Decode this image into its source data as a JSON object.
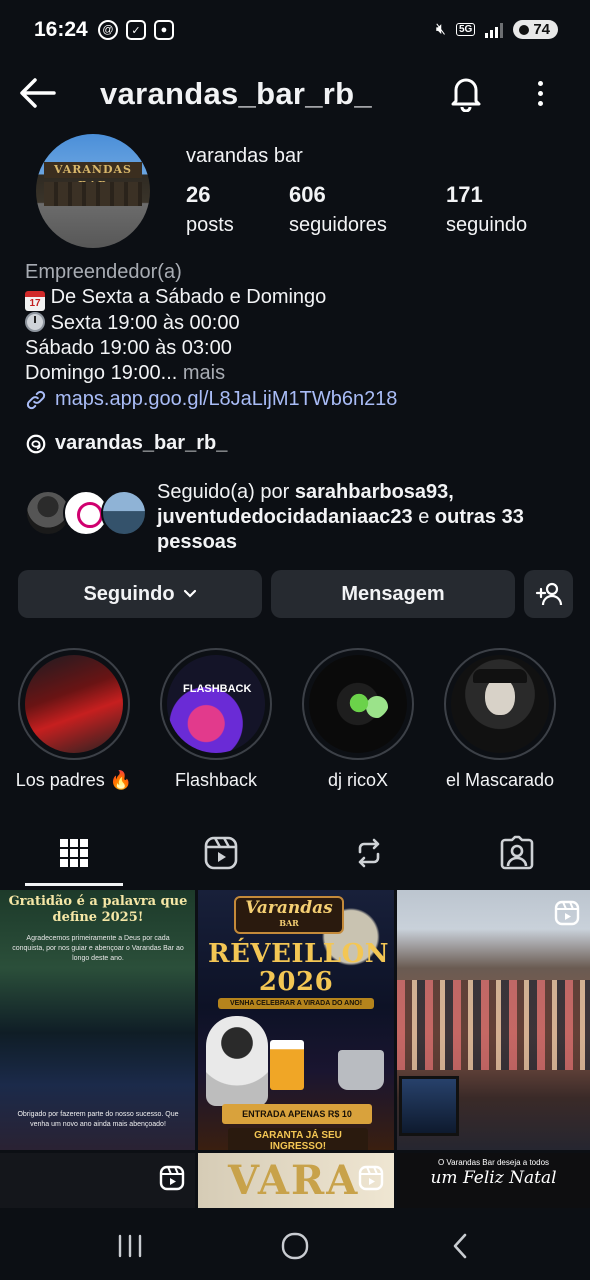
{
  "status_bar": {
    "time": "16:24",
    "network": "5G",
    "battery": "74"
  },
  "header": {
    "username": "varandas_bar_rb_",
    "icons": [
      "back-arrow-icon",
      "bell-icon",
      "more-vertical-icon"
    ]
  },
  "profile": {
    "avatar_sign": "VARANDAS BAR",
    "display_name": "varandas bar",
    "stats": {
      "posts": {
        "value": "26",
        "label": "posts"
      },
      "followers": {
        "value": "606",
        "label": "seguidores"
      },
      "following": {
        "value": "171",
        "label": "seguindo"
      }
    },
    "category": "Empreendedor(a)",
    "bio_lines": [
      "De Sexta a Sábado e Domingo",
      "Sexta 19:00 às 00:00",
      "Sábado 19:00 às 03:00",
      "Domingo 19:00..."
    ],
    "bio_more": "mais",
    "link": "maps.app.goo.gl/L8JaLijM1TWb6n218",
    "threads_handle": "varandas_bar_rb_",
    "followed_by": {
      "prefix": "Seguido(a) por",
      "user1": "sarahbarbosa93,",
      "user2": "juventudedocidadaniaac23",
      "connector": "e",
      "others": "outras 33 pessoas"
    }
  },
  "actions": {
    "following_label": "Seguindo",
    "message_label": "Mensagem"
  },
  "highlights": [
    {
      "label": "Los padres 🔥"
    },
    {
      "label": "Flashback",
      "cover_text": "FLASHBACK"
    },
    {
      "label": "dj ricoX"
    },
    {
      "label": "el Mascarado"
    }
  ],
  "tabs": [
    "grid-icon",
    "reels-icon",
    "reposts-icon",
    "tagged-icon"
  ],
  "posts": {
    "p1": {
      "title": "Gratidão é a palavra que define 2025!",
      "body": "Agradecemos primeiramente a Deus por cada conquista, por nos guiar e abençoar o Varandas Bar ao longo deste ano.",
      "footer": "Obrigado por fazerem parte do nosso sucesso. Que venha um novo ano ainda mais abençoado!"
    },
    "p2": {
      "brand": "Varandas",
      "brand_sub": "BAR",
      "title": "RÉVEILLON 2026",
      "subtitle": "VENHA CELEBRAR A VIRADA DO ANO!",
      "price": "ENTRADA APENAS R$ 10",
      "cta": "GARANTA JÁ SEU INGRESSO!"
    },
    "p5": {
      "text": "VARA"
    },
    "p6": {
      "line1": "O Varandas Bar deseja a todos",
      "line2": "um Feliz Natal"
    }
  }
}
